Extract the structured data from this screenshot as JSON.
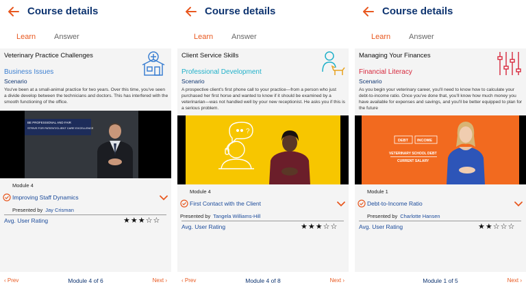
{
  "colors": {
    "accent": "#e8571e",
    "navy": "#0e3470",
    "link": "#1a4a9a",
    "business": "#3b7fd1",
    "professional": "#1fb0c9",
    "financial": "#d6263b"
  },
  "panels": [
    {
      "header_title": "Course details",
      "tabs": {
        "learn": "Learn",
        "answer": "Answer"
      },
      "course_title": "Veterinary Practice Challenges",
      "topic_icon": "clinic-building-icon",
      "category": "Business Issues",
      "scenario_label": "Scenario",
      "description": "You've been at a small-animal practice for two years. Over this time, you've seen a divide develop between the technicians and doctors. This has interfered with the smooth functioning of the office.",
      "video": {
        "banner_line1": "BE PROFESSIONAL AND FAIR",
        "banner_line2": "STRIVE FOR PATIENT/CLIENT CARE EXCELLENCE"
      },
      "module_number": "Module 4",
      "module_title": "Improving Staff Dynamics",
      "presented_by": "Presented by",
      "presenter": "Jay Crisman",
      "rating_label": "Avg. User Rating",
      "rating": 3,
      "rating_max": 5,
      "prev_label": "Prev",
      "next_label": "Next",
      "module_of": "Module 4 of 6"
    },
    {
      "header_title": "Course details",
      "tabs": {
        "learn": "Learn",
        "answer": "Answer"
      },
      "course_title": "Client Service Skills",
      "topic_icon": "person-with-dog-icon",
      "category": "Professional Development",
      "scenario_label": "Scenario",
      "description": "A prospective client's first phone call to your practice—from a person who just purchased her first horse and wanted to know if it should be examined by a veterinarian—was not handled well by your new receptionist. He asks you if this is a serious problem.",
      "video": {
        "bubble_text": "?"
      },
      "module_number": "Module 4",
      "module_title": "First Contact with the Client",
      "presented_by": "Presented by",
      "presenter": "Tangela Williams-Hill",
      "rating_label": "Avg. User Rating",
      "rating": 3,
      "rating_max": 5,
      "prev_label": "Prev",
      "next_label": "Next",
      "module_of": "Module 4 of 8"
    },
    {
      "header_title": "Course details",
      "tabs": {
        "learn": "Learn",
        "answer": "Answer"
      },
      "course_title": "Managing Your Finances",
      "topic_icon": "sliders-icon",
      "category": "Financial Literacy",
      "scenario_label": "Scenario",
      "description": "As you begin your veterinary career, you'll need to know how to calculate your debt-to-income ratio. Once you've done that, you'll know how much money you have available for expenses and savings, and you'll be better equipped to plan for the future",
      "video": {
        "tag_debt": "DEBT",
        "tag_income": "INCOME",
        "line1": "VETERINARY SCHOOL DEBT",
        "line2": "CURRENT SALARY"
      },
      "module_number": "Module 1",
      "module_title": "Debt-to-Income Ratio",
      "presented_by": "Presented by",
      "presenter": "Charlotte Hansen",
      "rating_label": "Avg. User Rating",
      "rating": 2,
      "rating_max": 5,
      "prev_label": "Prev",
      "next_label": "Next",
      "module_of": "Module 1 of 5"
    }
  ]
}
